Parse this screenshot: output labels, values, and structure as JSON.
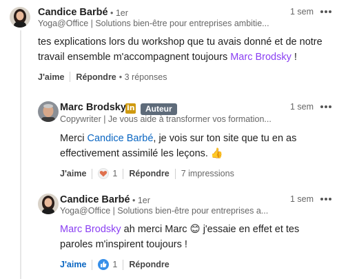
{
  "comments": [
    {
      "author": "Candice Barbé",
      "degree": "• 1er",
      "headline": "Yoga@Office | Solutions bien-être pour entreprises ambitie...",
      "time": "1 sem",
      "text_before": "tes explications lors du workshop que tu avais donné et de notre travail ensemble m'accompagnent toujours ",
      "mention": "Marc Brodsky",
      "text_after": " !",
      "like_label": "J'aime",
      "reply_label": "Répondre",
      "replies_count": "• 3 réponses"
    },
    {
      "author": "Marc Brodsky",
      "badge": "Auteur",
      "li_badge": "in",
      "headline": "Copywriter | Je vous aide à transformer vos formation...",
      "time": "1 sem",
      "text_before": "Merci ",
      "mention": "Candice Barbé",
      "text_after": ", je vois sur ton site que tu en as effectivement assimilé les leçons. 👍",
      "like_label": "J'aime",
      "reaction_icon": "heart-reaction-icon",
      "reaction_count": "1",
      "reply_label": "Répondre",
      "impressions": "7 impressions"
    },
    {
      "author": "Candice Barbé",
      "degree": "• 1er",
      "headline": "Yoga@Office | Solutions bien-être pour entreprises a...",
      "time": "1 sem",
      "mention": "Marc Brodsky",
      "text_after": " ah merci Marc 😊 j'essaie en effet et tes paroles m'inspirent toujours !",
      "like_label": "J'aime",
      "reaction_icon": "thumbs-up-reaction-icon",
      "reaction_count": "1",
      "reply_label": "Répondre"
    }
  ],
  "colors": {
    "mention_purple": "#8a3ff2",
    "mention_blue": "#0a66c2",
    "author_badge": "#5e6b7a",
    "li_badge": "#cf9a10",
    "thread_line": "#e6e6e6"
  }
}
